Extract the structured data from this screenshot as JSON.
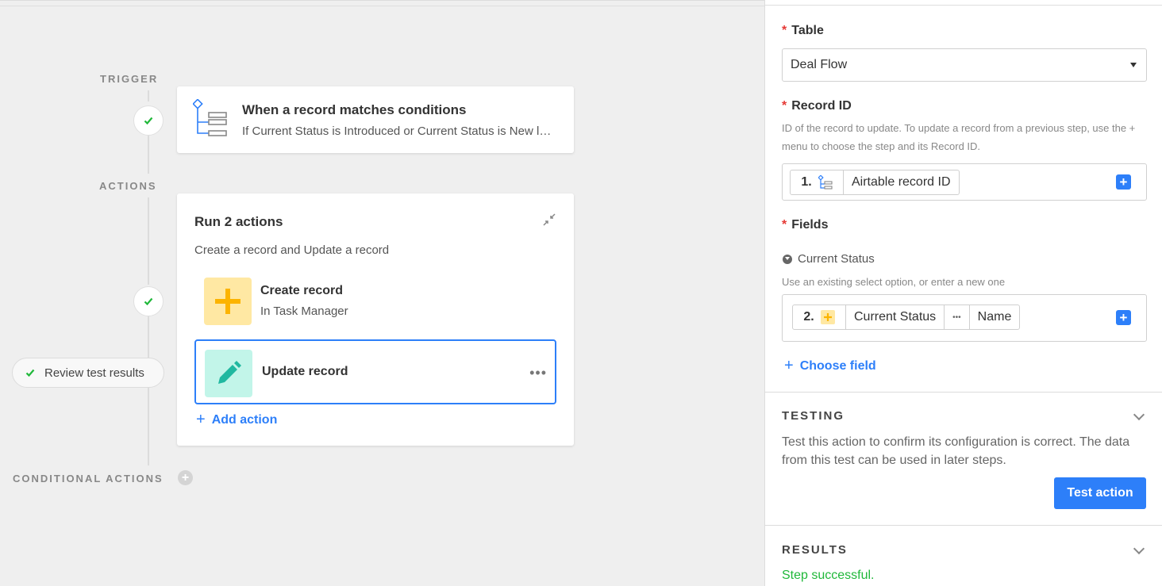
{
  "canvas": {
    "trigger_label": "TRIGGER",
    "actions_label": "ACTIONS",
    "conditional_label": "CONDITIONAL ACTIONS",
    "trigger_card": {
      "title": "When a record matches conditions",
      "subtitle": "If Current Status is Introduced or Current Status is New lead"
    },
    "actions_card": {
      "title": "Run 2 actions",
      "subtitle": "Create a record and Update a record",
      "items": [
        {
          "title": "Create record",
          "subtitle": "In Task Manager",
          "icon": "plus-icon",
          "color": "#ffe8a3"
        },
        {
          "title": "Update record",
          "subtitle": "",
          "icon": "pencil-icon",
          "color": "#c2f5e9"
        }
      ],
      "add_action": "Add action"
    },
    "review_test_results": "Review test results"
  },
  "panel": {
    "table": {
      "label": "Table",
      "value": "Deal Flow"
    },
    "record_id": {
      "label": "Record ID",
      "help": "ID of the record to update. To update a record from a previous step, use the + menu to choose the step and its Record ID.",
      "token_step": "1.",
      "token_value": "Airtable record ID"
    },
    "fields": {
      "label": "Fields",
      "field_name": "Current Status",
      "field_help": "Use an existing select option, or enter a new one",
      "token_step": "2.",
      "token_field": "Current Status",
      "token_sep": "•••",
      "token_value": "Name",
      "choose_field": "Choose field"
    },
    "testing": {
      "heading": "TESTING",
      "description": "Test this action to confirm its configuration is correct. The data from this test can be used in later steps.",
      "button": "Test action"
    },
    "results": {
      "heading": "RESULTS",
      "status": "Step successful."
    }
  },
  "colors": {
    "accent": "#2d7ff9",
    "success": "#20b83a",
    "required": "#e53935"
  }
}
